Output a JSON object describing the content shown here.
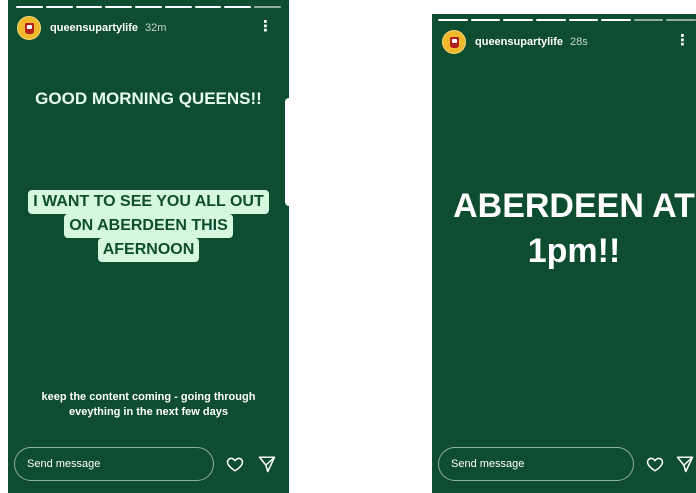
{
  "stories": [
    {
      "username": "queensupartylife",
      "time": "32m",
      "headline": "GOOD MORNING QUEENS!!",
      "highlight_lines": [
        "I WANT TO SEE YOU ALL OUT",
        "ON ABERDEEN THIS",
        "AFERNOON"
      ],
      "caption_lines": [
        "keep the content coming - going through",
        "eveything in the next few days"
      ],
      "composer_placeholder": "Send message"
    },
    {
      "username": "queensupartylife",
      "time": "28s",
      "big_lines": [
        "ABERDEEN AT",
        "1pm!!"
      ],
      "composer_placeholder": "Send message"
    }
  ],
  "colors": {
    "story_bg": "#0e4d2f",
    "highlight_bg": "#d4f7dd"
  },
  "icons": [
    "avatar-cup-icon",
    "more-vertical-icon",
    "heart-icon",
    "send-icon"
  ]
}
